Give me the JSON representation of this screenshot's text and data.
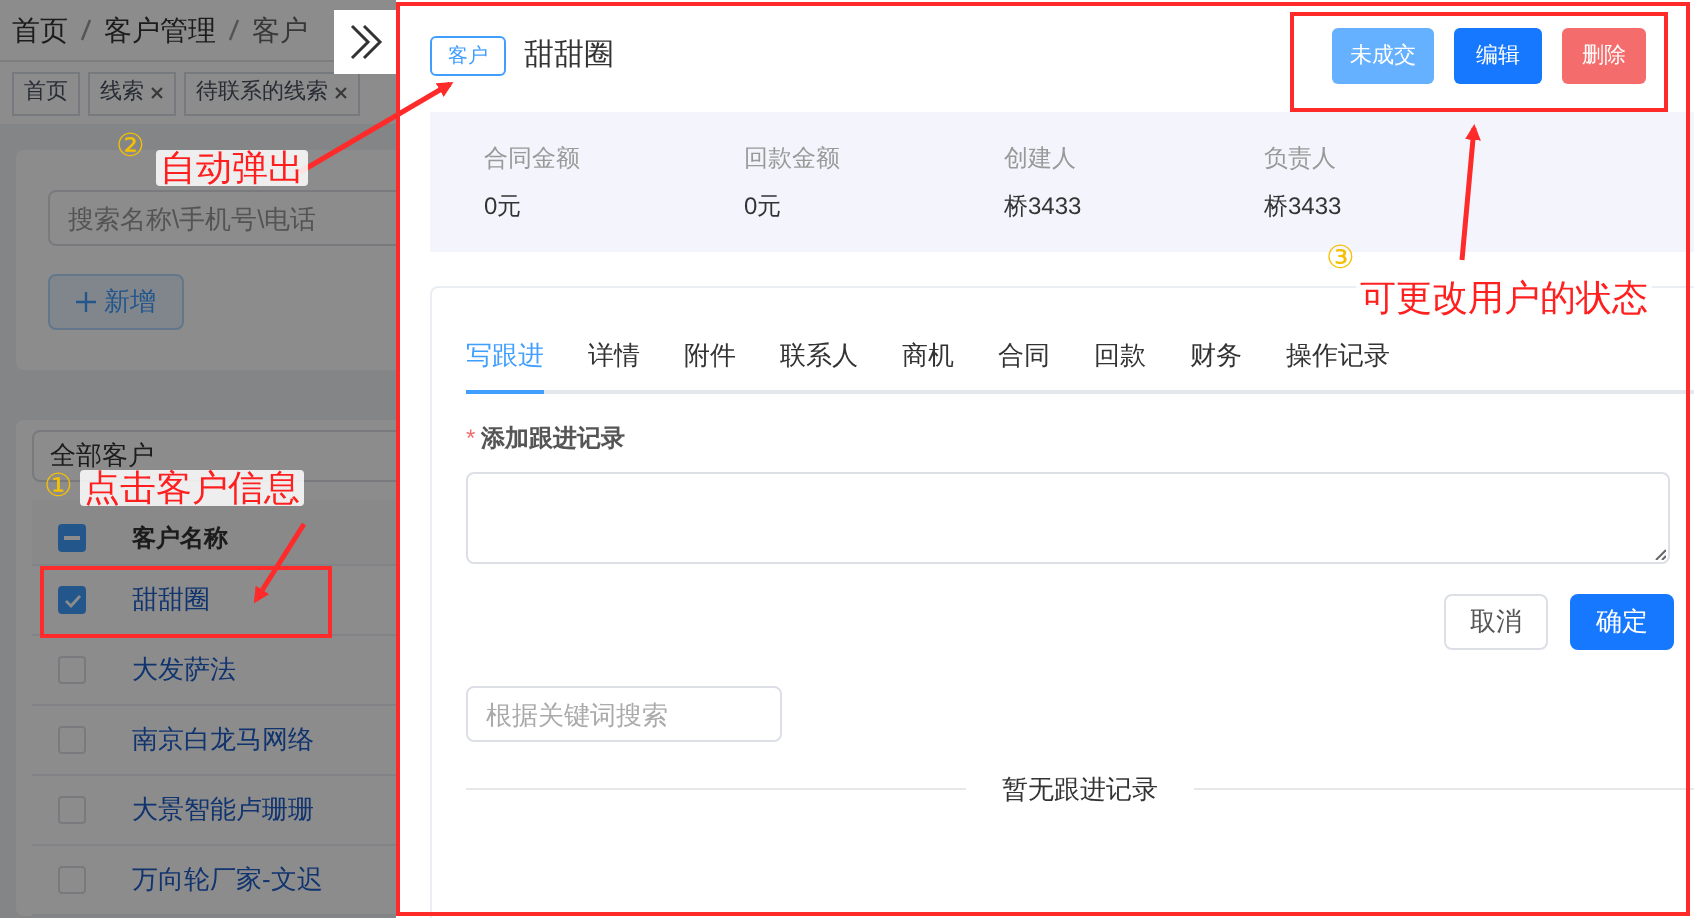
{
  "breadcrumb": [
    "首页",
    "客户管理",
    "客户"
  ],
  "tags": [
    {
      "label": "首页",
      "closable": false
    },
    {
      "label": "线索",
      "closable": true
    },
    {
      "label": "待联系的线索",
      "closable": true
    }
  ],
  "search": {
    "placeholder": "搜索名称\\手机号\\电话"
  },
  "add_button": {
    "label": "新增"
  },
  "filter": {
    "value": "全部客户"
  },
  "table": {
    "column": "客户名称",
    "header_partial": true,
    "rows": [
      {
        "name": "甜甜圈",
        "checked": true
      },
      {
        "name": "大发萨法",
        "checked": false
      },
      {
        "name": "南京白龙马网络",
        "checked": false
      },
      {
        "name": "大景智能卢珊珊",
        "checked": false
      },
      {
        "name": "万向轮厂家-文迟",
        "checked": false
      }
    ]
  },
  "drawer": {
    "badge": "客户",
    "title": "甜甜圈",
    "actions": [
      {
        "label": "未成交",
        "kind": "status"
      },
      {
        "label": "编辑",
        "kind": "primary"
      },
      {
        "label": "删除",
        "kind": "danger"
      }
    ],
    "stats": [
      {
        "label": "合同金额",
        "value": "0元"
      },
      {
        "label": "回款金额",
        "value": "0元"
      },
      {
        "label": "创建人",
        "value": "桥3433"
      },
      {
        "label": "负责人",
        "value": "桥3433"
      }
    ],
    "tabs": [
      {
        "label": "写跟进",
        "selected": true
      },
      {
        "label": "详情",
        "selected": false
      },
      {
        "label": "附件",
        "selected": false
      },
      {
        "label": "联系人",
        "selected": false
      },
      {
        "label": "商机",
        "selected": false
      },
      {
        "label": "合同",
        "selected": false
      },
      {
        "label": "回款",
        "selected": false
      },
      {
        "label": "财务",
        "selected": false
      },
      {
        "label": "操作记录",
        "selected": false
      }
    ],
    "form": {
      "required": true,
      "required_mark": "*",
      "label": "添加跟进记录",
      "buttons": [
        {
          "label": "取消",
          "kind": "default"
        },
        {
          "label": "确定",
          "kind": "primary"
        }
      ]
    },
    "record_search": {
      "placeholder": "根据关键词搜索"
    },
    "empty_text": "暂无跟进记录"
  },
  "annotations": [
    {
      "number": "②",
      "text": "自动弹出"
    },
    {
      "number": "③",
      "text": "可更改用户的状态"
    },
    {
      "number": "①",
      "text": "点击客户信息"
    }
  ]
}
